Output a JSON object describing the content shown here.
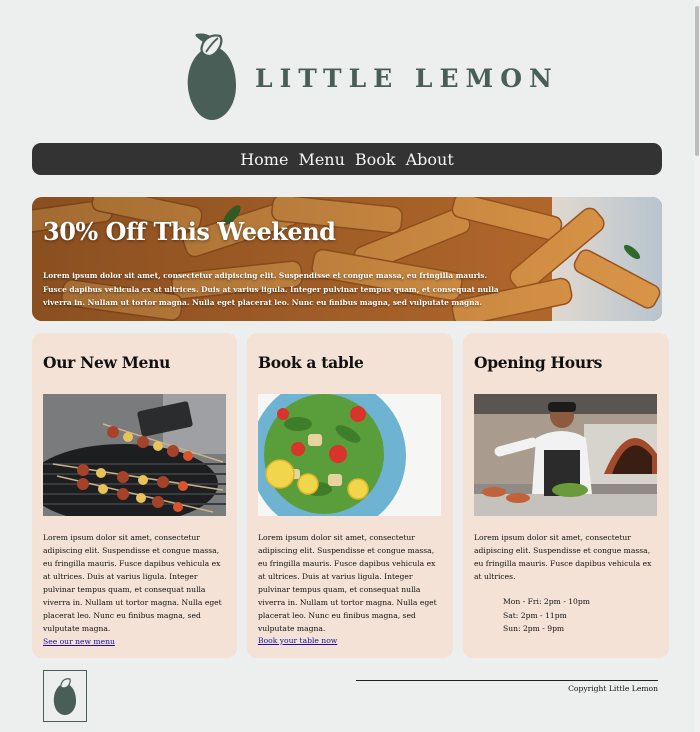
{
  "brand": {
    "name": "LITTLE LEMON",
    "color": "#495e57"
  },
  "nav": {
    "items": [
      "Home",
      "Menu",
      "Book",
      "About"
    ],
    "background": "#333333"
  },
  "hero": {
    "title": "30% Off This Weekend",
    "text": "Lorem ipsum dolor sit amet, consectetur adipiscing elit. Suspendisse et congue massa, eu fringilla mauris. Fusce dapibus vehicula ex at ultrices. Duis at varius ligula. Integer pulvinar tempus quam, et consequat nulla viverra in. Nullam ut tortor magna. Nulla eget placerat leo. Nunc eu finibus magna, sed vulputate magna."
  },
  "cards": [
    {
      "title": "Our New Menu",
      "image": "grilled-skewers-image",
      "body": "Lorem ipsum dolor sit amet, consectetur adipiscing elit. Suspendisse et congue massa, eu fringilla mauris. Fusce dapibus vehicula ex at ultrices. Duis at varius ligula. Integer pulvinar tempus quam, et consequat nulla viverra in. Nullam ut tortor magna. Nulla eget placerat leo. Nunc eu finibus magna, sed vulputate magna.",
      "link": "See our new menu"
    },
    {
      "title": "Book a table",
      "image": "salad-plate-image",
      "body": "Lorem ipsum dolor sit amet, consectetur adipiscing elit. Suspendisse et congue massa, eu fringilla mauris. Fusce dapibus vehicula ex at ultrices. Duis at varius ligula. Integer pulvinar tempus quam, et consequat nulla viverra in. Nullam ut tortor magna. Nulla eget placerat leo. Nunc eu finibus magna, sed vulputate magna.",
      "link": "Book your table now"
    },
    {
      "title": "Opening Hours",
      "image": "chef-cooking-image",
      "body": "Lorem ipsum dolor sit amet, consectetur adipiscing elit. Suspendisse et congue massa, eu fringilla mauris. Fusce dapibus vehicula ex at ultrices.",
      "hours": [
        "Mon - Fri: 2pm - 10pm",
        "Sat: 2pm - 11pm",
        "Sun: 2pm - 9pm"
      ]
    }
  ],
  "footer": {
    "copyright": "Copyright Little Lemon",
    "logo": "lemon-icon"
  },
  "colors": {
    "page_background": "#edeeee",
    "card_background": "#f3e2d5",
    "link": "#1a0dab"
  }
}
